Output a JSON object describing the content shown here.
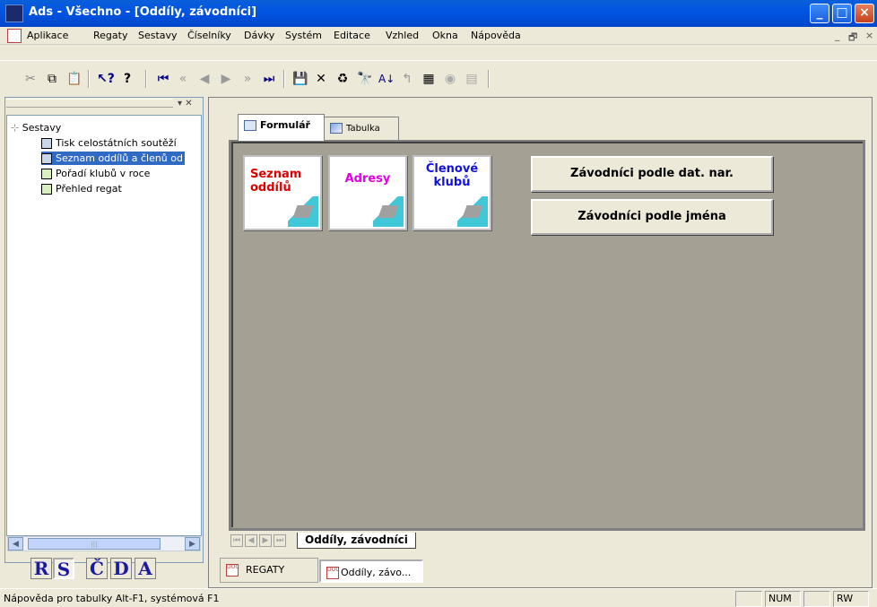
{
  "window": {
    "title": "Ads - Všechno - [Oddíly, závodníci]"
  },
  "menu": [
    "Aplikace",
    "Regaty",
    "Sestavy",
    "Číselníky",
    "Dávky",
    "Systém",
    "Editace",
    "Vzhled",
    "Okna",
    "Nápověda"
  ],
  "mdi_controls": {
    "minimize": "_",
    "restore": "🗗",
    "close": "×"
  },
  "toolbar_icons": [
    "cut-icon",
    "copy-icon",
    "paste-icon",
    "context-help-icon",
    "help-icon",
    "first-record-icon",
    "prev-page-icon",
    "prev-record-icon",
    "next-record-icon",
    "next-page-icon",
    "last-record-icon",
    "save-icon",
    "delete-icon",
    "refresh-icon",
    "find-icon",
    "sort-icon",
    "filter-icon",
    "copy-record-icon",
    "radio-icon",
    "grid-icon"
  ],
  "tree": {
    "root": "Sestavy",
    "items": [
      {
        "label": "Tisk celostátních soutěží",
        "icon": "table-icon"
      },
      {
        "label": "Seznam oddílů a členů od",
        "icon": "table-icon",
        "selected": true
      },
      {
        "label": "Pořadí klubů v roce",
        "icon": "report-icon"
      },
      {
        "label": "Přehled regat",
        "icon": "report-icon"
      }
    ]
  },
  "rs_buttons": [
    "R",
    "S",
    "Č",
    "D",
    "A"
  ],
  "tabs": [
    {
      "label": "Formulář",
      "active": true
    },
    {
      "label": "Tabulka",
      "active": false
    }
  ],
  "cards": [
    {
      "label": "Seznam oddílů",
      "color": "#e00000"
    },
    {
      "label": "Adresy",
      "color": "#e000e0"
    },
    {
      "label": "Členové klubů",
      "color": "#1010e0"
    }
  ],
  "buttons": [
    "Závodníci podle dat. nar.",
    "Závodníci podle jména"
  ],
  "sheet_tab": "Oddíly, závodníci",
  "task_tabs": [
    "REGATY",
    "Oddíly, závo..."
  ],
  "status": {
    "text": "Nápověda pro tabulky Alt-F1, systémová  F1",
    "num": "NUM",
    "rw": "RW"
  }
}
